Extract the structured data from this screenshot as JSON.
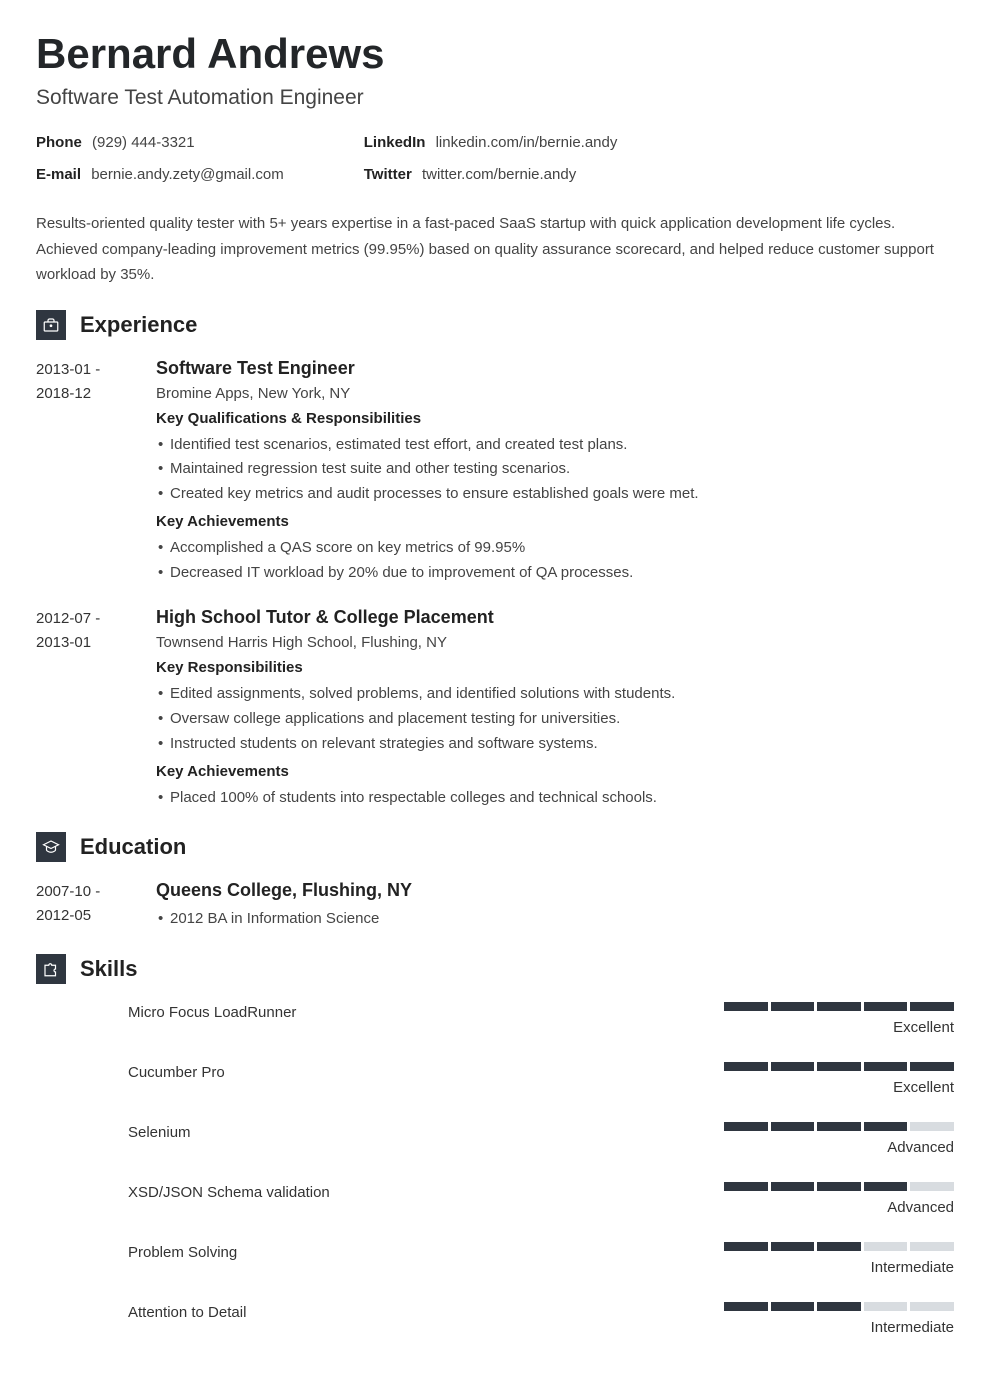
{
  "header": {
    "name": "Bernard Andrews",
    "title": "Software Test Automation Engineer"
  },
  "contact": {
    "left": [
      {
        "label": "Phone",
        "value": "(929) 444-3321"
      },
      {
        "label": "E-mail",
        "value": "bernie.andy.zety@gmail.com"
      }
    ],
    "right": [
      {
        "label": "LinkedIn",
        "value": "linkedin.com/in/bernie.andy"
      },
      {
        "label": "Twitter",
        "value": "twitter.com/bernie.andy"
      }
    ]
  },
  "summary": "Results-oriented quality tester with 5+ years expertise in a fast-paced SaaS startup with quick application development life cycles. Achieved company-leading improvement metrics (99.95%) based on quality assurance scorecard, and helped reduce customer support workload by 35%.",
  "sections": {
    "experience": {
      "title": "Experience",
      "entries": [
        {
          "date_from": "2013-01 -",
          "date_to": "2018-12",
          "title": "Software Test Engineer",
          "sub": "Bromine Apps, New York, NY",
          "blocks": [
            {
              "heading": "Key Qualifications & Responsibilities",
              "items": [
                "Identified test scenarios, estimated test effort, and created test plans.",
                "Maintained regression test suite and other testing scenarios.",
                "Created key metrics and audit processes to ensure established goals were met."
              ]
            },
            {
              "heading": "Key Achievements",
              "items": [
                "Accomplished a QAS score on key metrics of 99.95%",
                "Decreased IT workload by 20% due to improvement of QA processes."
              ]
            }
          ]
        },
        {
          "date_from": "2012-07 -",
          "date_to": "2013-01",
          "title": "High School Tutor & College Placement",
          "sub": "Townsend Harris High School, Flushing, NY",
          "blocks": [
            {
              "heading": "Key Responsibilities",
              "items": [
                "Edited assignments, solved problems, and identified solutions with students.",
                "Oversaw college applications and placement testing for universities.",
                "Instructed students on relevant strategies and software systems."
              ]
            },
            {
              "heading": "Key Achievements",
              "items": [
                "Placed 100% of students into respectable colleges and technical schools."
              ]
            }
          ]
        }
      ]
    },
    "education": {
      "title": "Education",
      "entries": [
        {
          "date_from": "2007-10 -",
          "date_to": "2012-05",
          "title": "Queens College, Flushing, NY",
          "items": [
            "2012 BA in Information Science"
          ]
        }
      ]
    },
    "skills": {
      "title": "Skills",
      "items": [
        {
          "name": "Micro Focus LoadRunner",
          "level": "Excellent",
          "filled": 5
        },
        {
          "name": "Cucumber Pro",
          "level": "Excellent",
          "filled": 5
        },
        {
          "name": "Selenium",
          "level": "Advanced",
          "filled": 4
        },
        {
          "name": "XSD/JSON Schema validation",
          "level": "Advanced",
          "filled": 4
        },
        {
          "name": "Problem Solving",
          "level": "Intermediate",
          "filled": 3
        },
        {
          "name": "Attention to Detail",
          "level": "Intermediate",
          "filled": 3
        }
      ]
    }
  }
}
